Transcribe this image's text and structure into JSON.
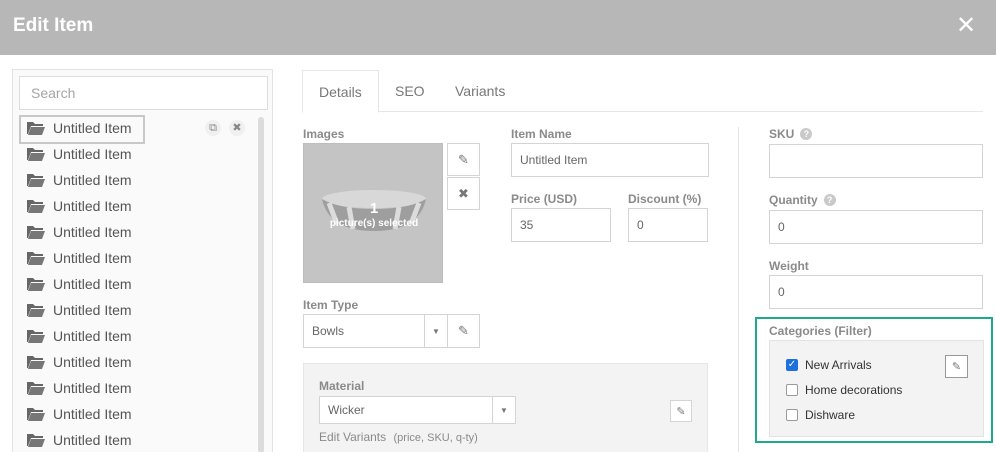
{
  "window": {
    "title": "Edit Item",
    "close_icon": "close-icon"
  },
  "sidebar": {
    "search_placeholder": "Search",
    "items": [
      "Untitled Item",
      "Untitled Item",
      "Untitled Item",
      "Untitled Item",
      "Untitled Item",
      "Untitled Item",
      "Untitled Item",
      "Untitled Item",
      "Untitled Item",
      "Untitled Item",
      "Untitled Item",
      "Untitled Item",
      "Untitled Item"
    ]
  },
  "tabs": [
    "Details",
    "SEO",
    "Variants"
  ],
  "images": {
    "label": "Images",
    "count": "1",
    "count_text": "picture(s) selected"
  },
  "item_name": {
    "label": "Item Name",
    "value": "Untitled Item"
  },
  "price": {
    "label": "Price (USD)",
    "value": "35"
  },
  "discount": {
    "label": "Discount (%)",
    "value": "0"
  },
  "item_type": {
    "label": "Item Type",
    "value": "Bowls"
  },
  "material": {
    "label": "Material",
    "value": "Wicker",
    "edit_variants": "Edit Variants",
    "edit_variants_hint": "(price, SKU, q-ty)"
  },
  "sku": {
    "label": "SKU",
    "value": ""
  },
  "quantity": {
    "label": "Quantity",
    "value": "0"
  },
  "weight": {
    "label": "Weight",
    "value": "0"
  },
  "categories": {
    "label": "Categories (Filter)",
    "options": [
      {
        "label": "New Arrivals",
        "checked": true
      },
      {
        "label": "Home decorations",
        "checked": false
      },
      {
        "label": "Dishware",
        "checked": false
      }
    ]
  },
  "colors": {
    "header": "#b7b7b7",
    "highlight": "#1ea98b",
    "checkbox": "#1e6fe0"
  }
}
